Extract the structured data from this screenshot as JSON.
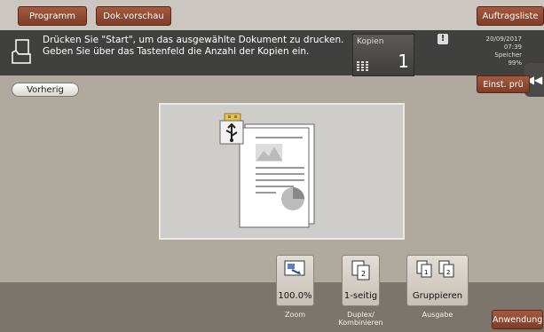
{
  "top_tabs": {
    "programm": "Programm",
    "dok_vorschau": "Dok.vorschau",
    "auftragsliste": "Auftragsliste"
  },
  "message": {
    "line1": "Drücken Sie \"Start\", um das ausgewählte Dokument zu drucken.",
    "line2": "Geben Sie über das Tastenfeld die Anzahl der Kopien ein."
  },
  "copies": {
    "label": "Kopien",
    "value": "1"
  },
  "status": {
    "date": "20/09/2017",
    "time": "07:39",
    "memory_label": "Speicher",
    "memory_value": "99%"
  },
  "buttons": {
    "vorherig": "Vorherig",
    "einst": "Einst. prü",
    "anwendung": "Anwendung"
  },
  "functions": [
    {
      "value": "100.0%",
      "label": "Zoom",
      "icon": "zoom-icon"
    },
    {
      "value": "1-seitig",
      "label": "Duplex/\nKombinieren",
      "icon": "simplex-icon"
    },
    {
      "value": "Gruppieren",
      "label": "Ausgabe",
      "icon": "group-icon"
    }
  ],
  "colors": {
    "accent": "#8f4630",
    "message_bg": "#40403e",
    "background": "#b0a99e"
  }
}
